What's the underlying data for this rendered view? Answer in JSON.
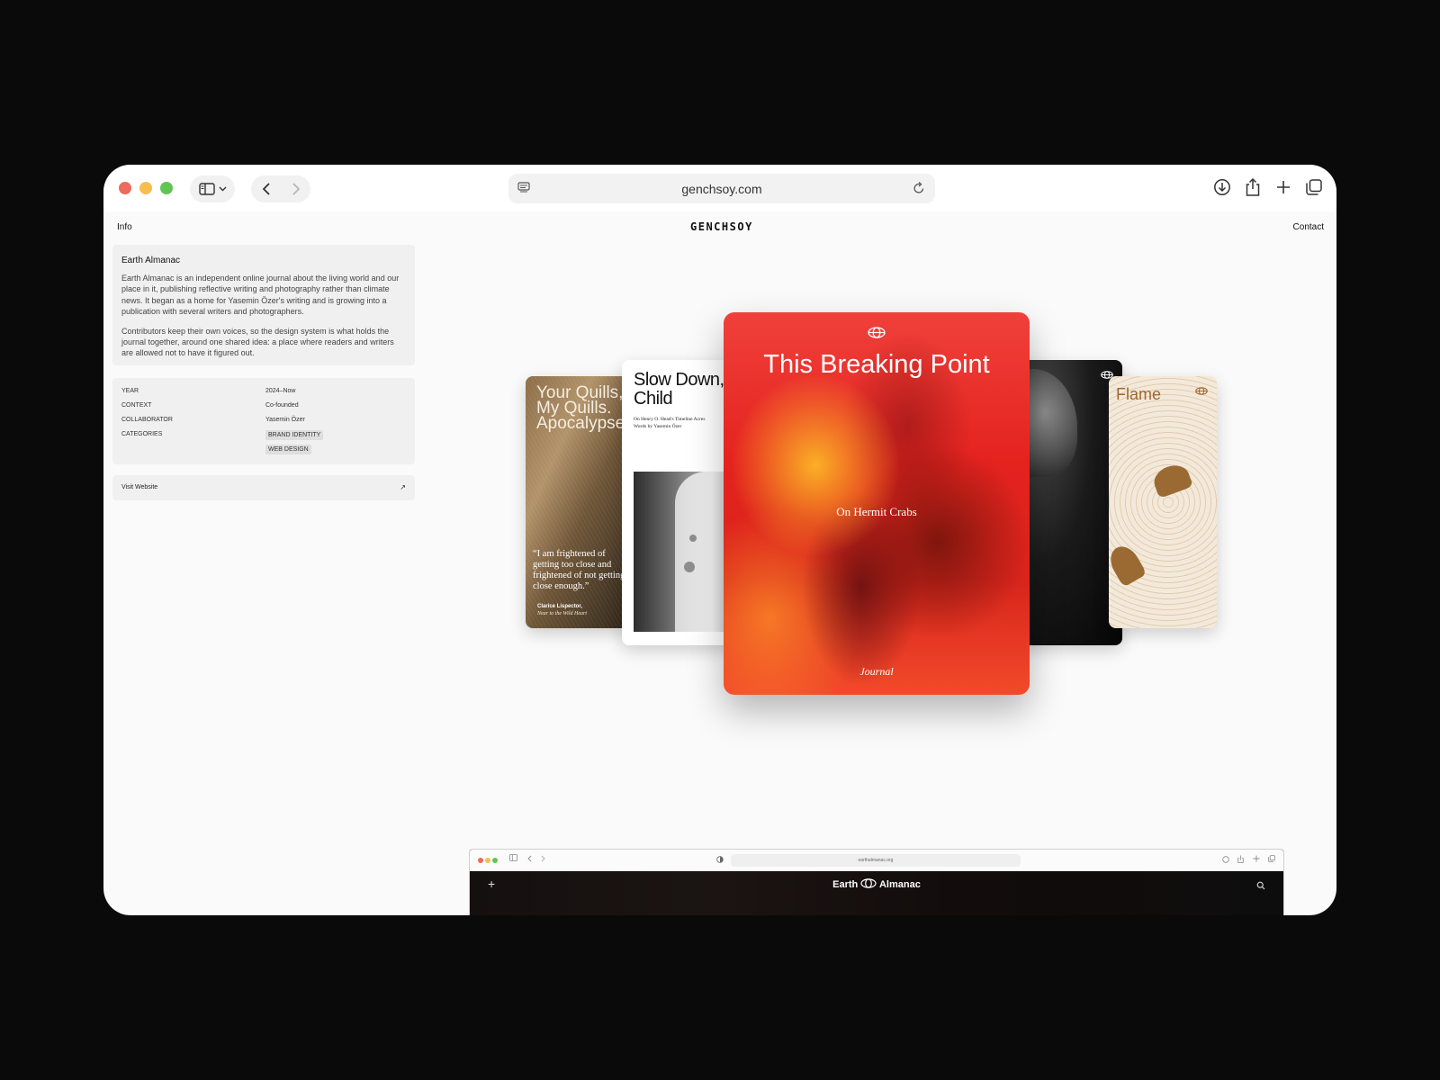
{
  "browser": {
    "url": "genchsoy.com"
  },
  "site": {
    "logo": "GENCHSOY",
    "info_link": "Info",
    "contact_link": "Contact"
  },
  "project": {
    "name": "Earth Almanac",
    "paragraphs": [
      "Earth Almanac is an independent online journal about the living world and our place in it, publishing reflective writing and photography rather than climate news. It began as a home for Yasemin Özer's writing and is growing into a publication with several writers and photographers.",
      "Contributors keep their own voices, so the design system is what holds the journal together, around one shared idea: a place where readers and writers are allowed not to have it figured out."
    ],
    "meta": {
      "year_label": "YEAR",
      "year": "2024–Now",
      "context_label": "CONTEXT",
      "context": "Co-founded",
      "collaborator_label": "COLLABORATOR",
      "collaborator": "Yasemin Özer",
      "categories_label": "CATEGORIES",
      "categories": [
        "BRAND IDENTITY",
        "WEB DESIGN"
      ]
    },
    "visit_label": "Visit Website",
    "visit_arrow": "↗"
  },
  "cards": {
    "quills": {
      "title": "Your Quills, My Quills. Apocalypse",
      "quote": "“I am frightened of getting too close and frightened of not getting close enough.”",
      "cite": "Clarice Lispector,",
      "cite_source": "Near to the Wild Heart"
    },
    "slow": {
      "title": "Slow Down, Crazy Child",
      "byline_1": "On Henry O. Head's Timeline Acres",
      "byline_2": "Words by Yasemin Özer"
    },
    "main": {
      "title": "This Breaking Point",
      "subtitle": "On Hermit Crabs",
      "foot": "Journal"
    },
    "flame": {
      "title": "Flame"
    }
  },
  "mini_browser": {
    "url": "earthalmanac.org",
    "logo_left": "Earth",
    "logo_right": "Almanac",
    "plus": "+"
  },
  "colors": {
    "background": "#0a0a0a",
    "window": "#fafafa",
    "panel": "#f0f0f0",
    "accent_red": "#e4221e",
    "flame_text": "#a0672e"
  },
  "icons": [
    "sidebar-icon",
    "chevron-down-icon",
    "back-icon",
    "forward-icon",
    "page-menu-icon",
    "reload-icon",
    "download-icon",
    "share-icon",
    "plus-icon",
    "tabs-icon",
    "globe-icon",
    "search-icon"
  ]
}
